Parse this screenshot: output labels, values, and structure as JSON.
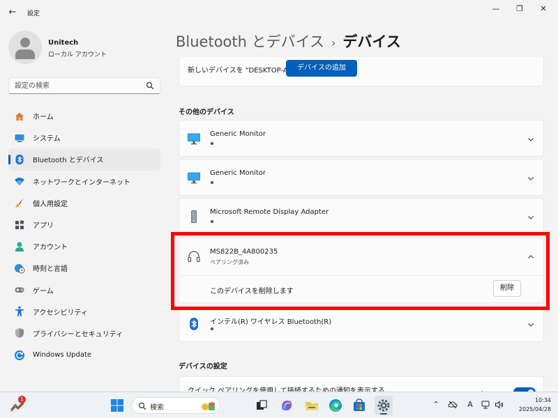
{
  "window": {
    "title": "設定",
    "back": "←",
    "minimize": "—",
    "maximize": "❐",
    "close": "✕"
  },
  "profile": {
    "name": "Unitech",
    "account_type": "ローカル アカウント"
  },
  "search": {
    "placeholder": "設定の検索"
  },
  "sidebar": {
    "items": [
      {
        "label": "ホーム",
        "icon": "home-icon"
      },
      {
        "label": "システム",
        "icon": "system-icon"
      },
      {
        "label": "Bluetooth とデバイス",
        "icon": "bluetooth-icon",
        "active": true
      },
      {
        "label": "ネットワークとインターネット",
        "icon": "wifi-icon"
      },
      {
        "label": "個人用設定",
        "icon": "brush-icon"
      },
      {
        "label": "アプリ",
        "icon": "apps-icon"
      },
      {
        "label": "アカウント",
        "icon": "account-icon"
      },
      {
        "label": "時刻と言語",
        "icon": "globe-clock-icon"
      },
      {
        "label": "ゲーム",
        "icon": "gamepad-icon"
      },
      {
        "label": "アクセシビリティ",
        "icon": "accessibility-icon"
      },
      {
        "label": "プライバシーとセキュリティ",
        "icon": "shield-icon"
      },
      {
        "label": "Windows Update",
        "icon": "update-icon"
      }
    ]
  },
  "main": {
    "breadcrumb_parent": "Bluetooth とデバイス",
    "breadcrumb_sep": "›",
    "breadcrumb_current": "デバイス",
    "pair_text": "新しいデバイスを \"DESKTOP-AT79F22\" に接続する",
    "add_button": "デバイスの追加",
    "other_devices_heading": "その他のデバイス",
    "devices": [
      {
        "name": "Generic Monitor",
        "icon": "monitor-icon"
      },
      {
        "name": "Generic Monitor",
        "icon": "monitor-icon"
      },
      {
        "name": "Microsoft Remote Display Adapter",
        "icon": "tower-icon"
      },
      {
        "name": "MS822B_4A800235",
        "icon": "headphones-icon",
        "status": "ペアリング済み",
        "expanded": true
      },
      {
        "name": "インテル(R) ワイヤレス Bluetooth(R)",
        "icon": "bluetooth-icon"
      }
    ],
    "remove_text": "このデバイスを削除します",
    "remove_button": "削除",
    "settings_heading": "デバイスの設定",
    "swift_pair_text": "クイック ペアリングを使用して接続するための通知を表示する",
    "swift_pair_state": "オン"
  },
  "taskbar": {
    "search_label": "検索",
    "notification_badge": "1",
    "time": "10:34",
    "date": "2025/04/28",
    "ime": "A"
  },
  "colors": {
    "accent": "#005fb8",
    "highlight": "#ff0000",
    "status_ok": "#107c10"
  }
}
